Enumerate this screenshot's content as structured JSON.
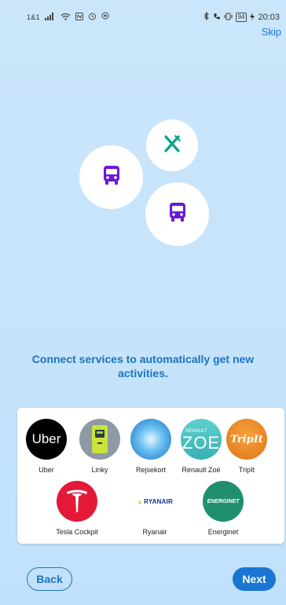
{
  "status_bar": {
    "carrier": "1&1",
    "signal_icon": "signal-bars-icon",
    "wifi_icon": "wifi-icon",
    "nfc_icon": "nfc-icon",
    "alarm_icon": "alarm-icon",
    "bluetooth_icon": "bluetooth-icon",
    "battery": "94",
    "time": "20:03"
  },
  "header": {
    "skip_label": "Skip"
  },
  "illustration": {
    "bubbles": [
      {
        "icon": "fork-knife-icon",
        "color": "#0aa38b"
      },
      {
        "icon": "bus-icon",
        "color": "#6a1bd6"
      },
      {
        "icon": "bus-icon",
        "color": "#6a1bd6"
      }
    ]
  },
  "headline": "Connect services to automatically get new activities.",
  "services": [
    {
      "label": "Uber",
      "logo_text": "Uber"
    },
    {
      "label": "Linky"
    },
    {
      "label": "Rejsekort"
    },
    {
      "label": "Renault Zoé",
      "logo_text_top": "RENAULT",
      "logo_text_main": "ZOE"
    },
    {
      "label": "TripIt",
      "logo_text": "TripIt"
    },
    {
      "label": "Tesla Cockpit"
    },
    {
      "label": "Ryanair",
      "logo_text": "RYANAIR"
    },
    {
      "label": "Energinet",
      "logo_text": "ENERGINET"
    }
  ],
  "footer": {
    "back_label": "Back",
    "next_label": "Next"
  },
  "colors": {
    "accent": "#1976d2",
    "background": "#c5e3fb"
  }
}
